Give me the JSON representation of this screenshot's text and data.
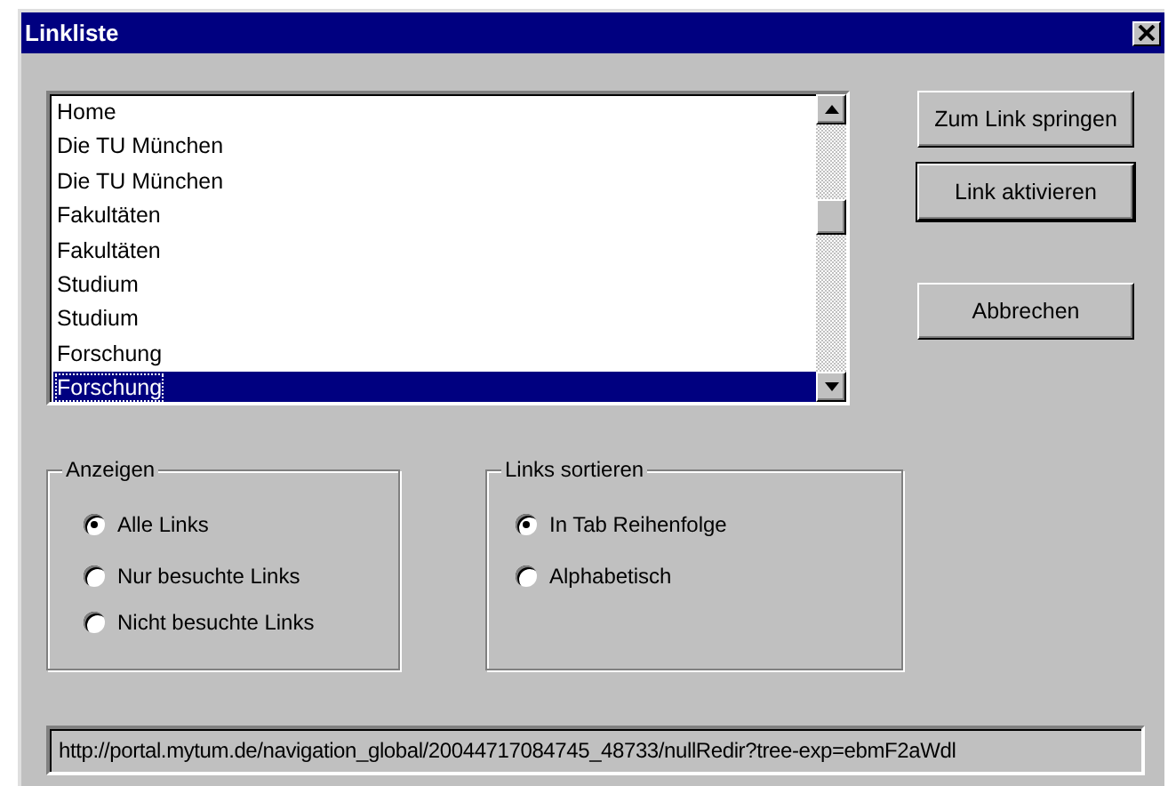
{
  "window": {
    "title": "Linkliste"
  },
  "links": [
    {
      "label": "Home",
      "selected": false
    },
    {
      "label": "Die TU München",
      "selected": false
    },
    {
      "label": "Die TU München",
      "selected": false
    },
    {
      "label": "Fakultäten",
      "selected": false
    },
    {
      "label": "Fakultäten",
      "selected": false
    },
    {
      "label": "Studium",
      "selected": false
    },
    {
      "label": "Studium",
      "selected": false
    },
    {
      "label": "Forschung",
      "selected": false
    },
    {
      "label": "Forschung",
      "selected": true
    }
  ],
  "buttons": [
    {
      "label": "Zum Link springen",
      "default": false
    },
    {
      "label": "Link aktivieren",
      "default": true
    },
    {
      "label": "Abbrechen",
      "default": false
    }
  ],
  "groups": [
    {
      "title": "Anzeigen",
      "options": [
        {
          "label": "Alle Links",
          "selected": true
        },
        {
          "label": "Nur besuchte Links",
          "selected": false
        },
        {
          "label": "Nicht besuchte Links",
          "selected": false
        }
      ]
    },
    {
      "title": "Links sortieren",
      "options": [
        {
          "label": "In Tab Reihenfolge",
          "selected": true
        },
        {
          "label": "Alphabetisch",
          "selected": false
        }
      ]
    }
  ],
  "url": {
    "value": "http://portal.mytum.de/navigation_global/20044717084745_48733/nullRedir?tree-exp=ebmF2aWdl"
  }
}
